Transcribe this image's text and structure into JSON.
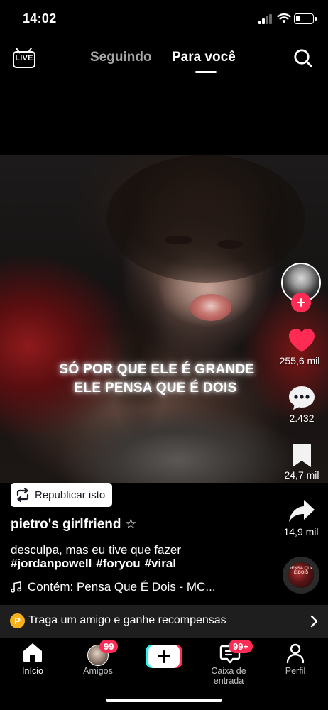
{
  "status_bar": {
    "time": "14:02",
    "battery_level": 0.2,
    "signal_bars": 2
  },
  "top_nav": {
    "live_label": "LIVE",
    "tabs": [
      {
        "label": "Seguindo",
        "active": false
      },
      {
        "label": "Para você",
        "active": true
      }
    ],
    "icons": {
      "live": "live-tv-icon",
      "search": "search-icon"
    }
  },
  "video": {
    "caption_lines": [
      "SÓ POR QUE ELE É GRANDE",
      "ELE PENSA QUE É DOIS"
    ]
  },
  "actions": {
    "likes": "255,6 mil",
    "comments": "2.432",
    "saves": "24,7 mil",
    "shares": "14,9 mil",
    "disc_text": "PENSA QUE É DOIS",
    "colors": {
      "like": "#fe2c55",
      "follow": "#fe2c55"
    }
  },
  "repost": {
    "label": "Republicar isto"
  },
  "info": {
    "author": "pietro's girlfriend ☆",
    "description": "desculpa, mas eu tive que fazer",
    "hashtags": [
      "#jordanpowell",
      "#foryou",
      "#viral"
    ],
    "music": "Contém: Pensa Que É Dois - MC..."
  },
  "referral": {
    "badge": "P",
    "text": "Traga um amigo e ganhe recompensas",
    "badge_color": "#f6b21d"
  },
  "bottom_nav": {
    "items": [
      {
        "label": "Início",
        "active": true
      },
      {
        "label": "Amigos",
        "badge": "99"
      },
      {
        "label": ""
      },
      {
        "label": "Caixa de entrada",
        "badge": "99+"
      },
      {
        "label": "Perfil"
      }
    ]
  }
}
